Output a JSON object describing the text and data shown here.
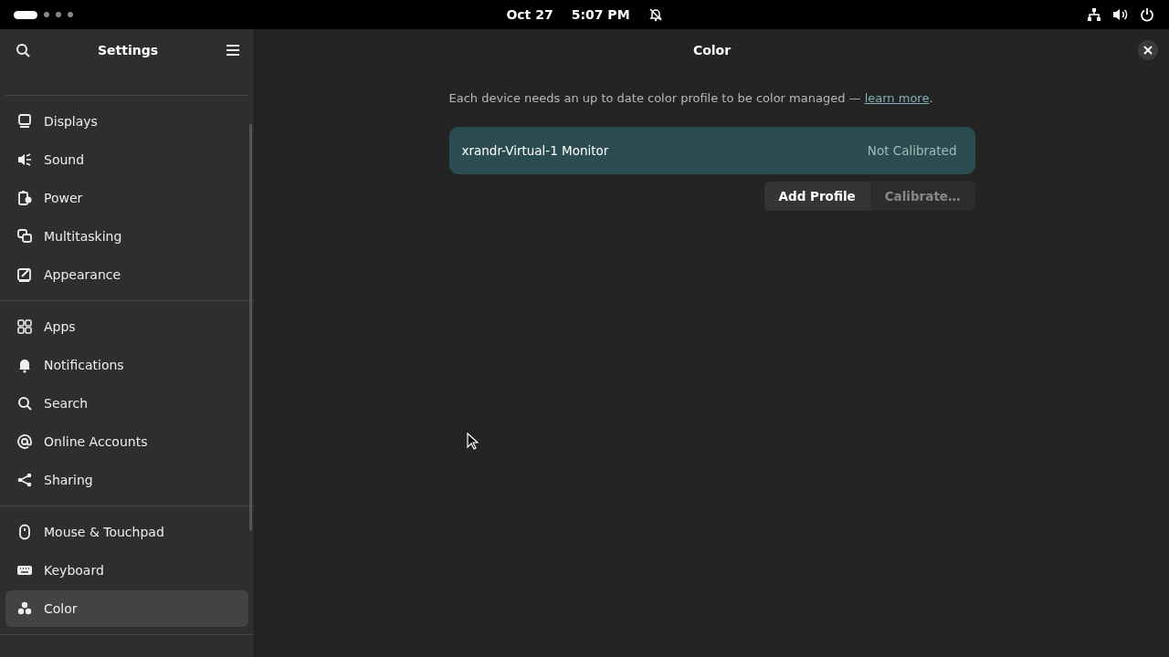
{
  "top_bar": {
    "date": "Oct 27",
    "time": "5:07 PM",
    "workspaces": [
      {
        "selected": true
      },
      {
        "selected": false
      },
      {
        "selected": false
      },
      {
        "selected": false
      }
    ]
  },
  "sidebar": {
    "title": "Settings",
    "sections": [
      {
        "items": [
          {
            "label": "Displays",
            "kind": "displays",
            "selected": false
          },
          {
            "label": "Sound",
            "kind": "sound",
            "selected": false
          },
          {
            "label": "Power",
            "kind": "power",
            "selected": false
          },
          {
            "label": "Multitasking",
            "kind": "multitasking",
            "selected": false
          },
          {
            "label": "Appearance",
            "kind": "appearance",
            "selected": false
          }
        ]
      },
      {
        "items": [
          {
            "label": "Apps",
            "kind": "apps",
            "selected": false
          },
          {
            "label": "Notifications",
            "kind": "notifications",
            "selected": false
          },
          {
            "label": "Search",
            "kind": "search",
            "selected": false
          },
          {
            "label": "Online Accounts",
            "kind": "accounts",
            "selected": false
          },
          {
            "label": "Sharing",
            "kind": "sharing",
            "selected": false
          }
        ]
      },
      {
        "items": [
          {
            "label": "Mouse & Touchpad",
            "kind": "mouse",
            "selected": false
          },
          {
            "label": "Keyboard",
            "kind": "keyboard",
            "selected": false
          },
          {
            "label": "Color",
            "kind": "color",
            "selected": true
          }
        ]
      }
    ]
  },
  "main": {
    "title": "Color",
    "description": "Each device needs an up to date color profile to be color managed — ",
    "link": "learn more",
    "after_link": ".",
    "devices": [
      {
        "name": "xrandr-Virtual-1 Monitor",
        "status": "Not Calibrated",
        "selected": true
      }
    ],
    "buttons": [
      {
        "label": "Add Profile",
        "disabled": false
      },
      {
        "label": "Calibrate…",
        "disabled": true
      }
    ]
  }
}
